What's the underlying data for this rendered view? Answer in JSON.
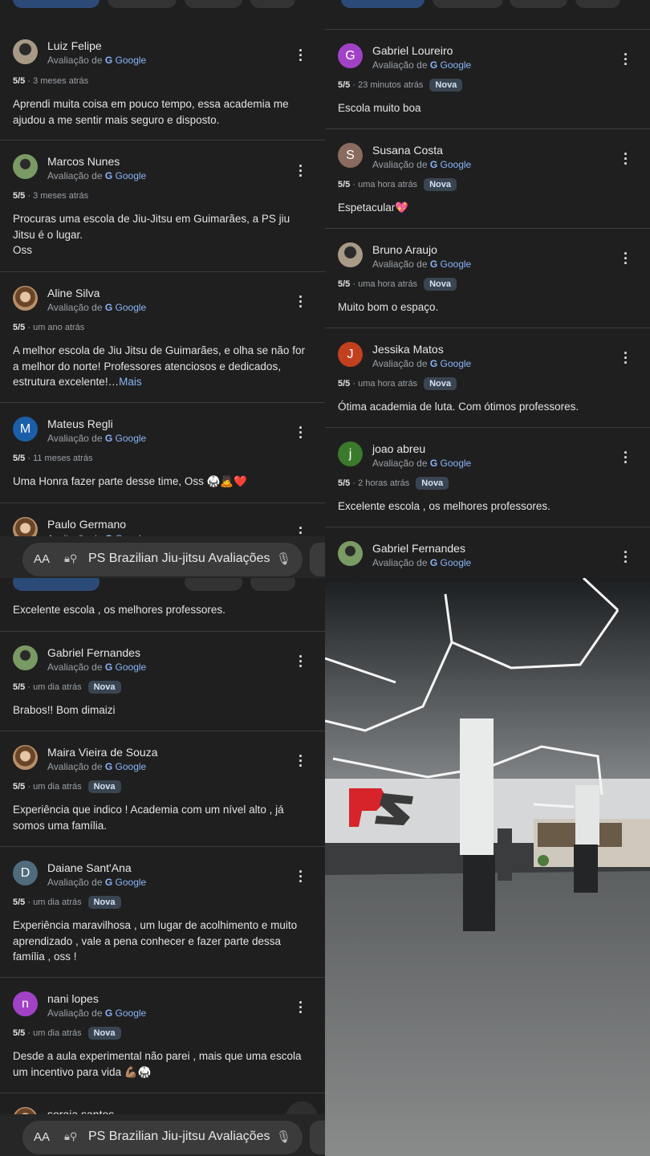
{
  "top_left": {
    "reviews": [
      {
        "name": "Luiz Felipe",
        "source": "Avaliação de",
        "provider": "Google",
        "rating": "5/5",
        "time": "3 meses atrás",
        "text": "Aprendi muita coisa em pouco tempo, essa academia me ajudou a me sentir mais seguro e disposto."
      },
      {
        "name": "Marcos Nunes",
        "source": "Avaliação de",
        "provider": "Google",
        "rating": "5/5",
        "time": "3 meses atrás",
        "text_lines": [
          "Procuras uma escola de Jiu-Jitsu em Guimarães, a PS jiu",
          "Jitsu é o lugar.",
          "Oss"
        ]
      },
      {
        "name": "Aline Silva",
        "source": "Avaliação de",
        "provider": "Google",
        "rating": "5/5",
        "time": "um ano atrás",
        "text": "A melhor escola de Jiu Jitsu de Guimarães, e olha se não for a melhor do norte! Professores atenciosos e dedicados, estrutura excelente!…",
        "more": "Mais"
      },
      {
        "initial": "M",
        "name": "Mateus Regli",
        "source": "Avaliação de",
        "provider": "Google",
        "rating": "5/5",
        "time": "11 meses atrás",
        "text": "Uma Honra fazer parte desse time, Oss 🥋🙇❤️"
      },
      {
        "name": "Paulo Germano",
        "source": "Avaliação de",
        "provider": "Google"
      }
    ],
    "address_bar": {
      "aa": "AA",
      "url": "PS Brazilian Jiu-jitsu Avaliações"
    }
  },
  "top_right": {
    "reviews": [
      {
        "initial": "G",
        "name": "Gabriel Loureiro",
        "source": "Avaliação de",
        "provider": "Google",
        "rating": "5/5",
        "time": "23 minutos atrás",
        "badge": "Nova",
        "text": "Escola muito boa"
      },
      {
        "initial": "S",
        "name": "Susana Costa",
        "source": "Avaliação de",
        "provider": "Google",
        "rating": "5/5",
        "time": "uma hora atrás",
        "badge": "Nova",
        "text": "Espetacular💖"
      },
      {
        "name": "Bruno Araujo",
        "source": "Avaliação de",
        "provider": "Google",
        "rating": "5/5",
        "time": "uma hora atrás",
        "badge": "Nova",
        "text": "Muito bom o espaço."
      },
      {
        "initial": "J",
        "name": "Jessika Matos",
        "source": "Avaliação de",
        "provider": "Google",
        "rating": "5/5",
        "time": "uma hora atrás",
        "badge": "Nova",
        "text": "Ótima academia de luta. Com ótimos professores."
      },
      {
        "initial": "j",
        "name": "joao abreu",
        "source": "Avaliação de",
        "provider": "Google",
        "rating": "5/5",
        "time": "2 horas atrás",
        "badge": "Nova",
        "text": "Excelente escola , os melhores professores."
      },
      {
        "name": "Gabriel Fernandes",
        "source": "Avaliação de",
        "provider": "Google"
      }
    ]
  },
  "bottom_left": {
    "partial_text": "Excelente escola , os melhores professores.",
    "reviews": [
      {
        "name": "Gabriel Fernandes",
        "source": "Avaliação de",
        "provider": "Google",
        "rating": "5/5",
        "time": "um dia atrás",
        "badge": "Nova",
        "text": "Brabos!! Bom dimaizi"
      },
      {
        "name": "Maira Vieira de Souza",
        "source": "Avaliação de",
        "provider": "Google",
        "rating": "5/5",
        "time": "um dia atrás",
        "badge": "Nova",
        "text": "Experiência que indico ! Academia com um nível alto , já somos uma família."
      },
      {
        "initial": "D",
        "name": "Daiane Sant'Ana",
        "source": "Avaliação de",
        "provider": "Google",
        "rating": "5/5",
        "time": "um dia atrás",
        "badge": "Nova",
        "text": "Experiência maravilhosa , um lugar de acolhimento e muito aprendizado , vale a pena conhecer e fazer parte dessa família , oss !"
      },
      {
        "initial": "n",
        "name": "nani lopes",
        "source": "Avaliação de",
        "provider": "Google",
        "rating": "5/5",
        "time": "um dia atrás",
        "badge": "Nova",
        "text": "Desde a aula experimental não parei , mais que uma escola um incentivo para vida 💪🏽🥋"
      },
      {
        "name": "soraia santos"
      }
    ],
    "address_bar": {
      "aa": "AA",
      "url": "PS Brazilian Jiu-jitsu Avaliações"
    }
  },
  "bottom_right": {
    "wall_logo": "PS"
  },
  "colors": {
    "background": "#1f1f1f",
    "link": "#8ab4f8",
    "badge_bg": "#3a4552",
    "divider": "#3c3c3c"
  }
}
